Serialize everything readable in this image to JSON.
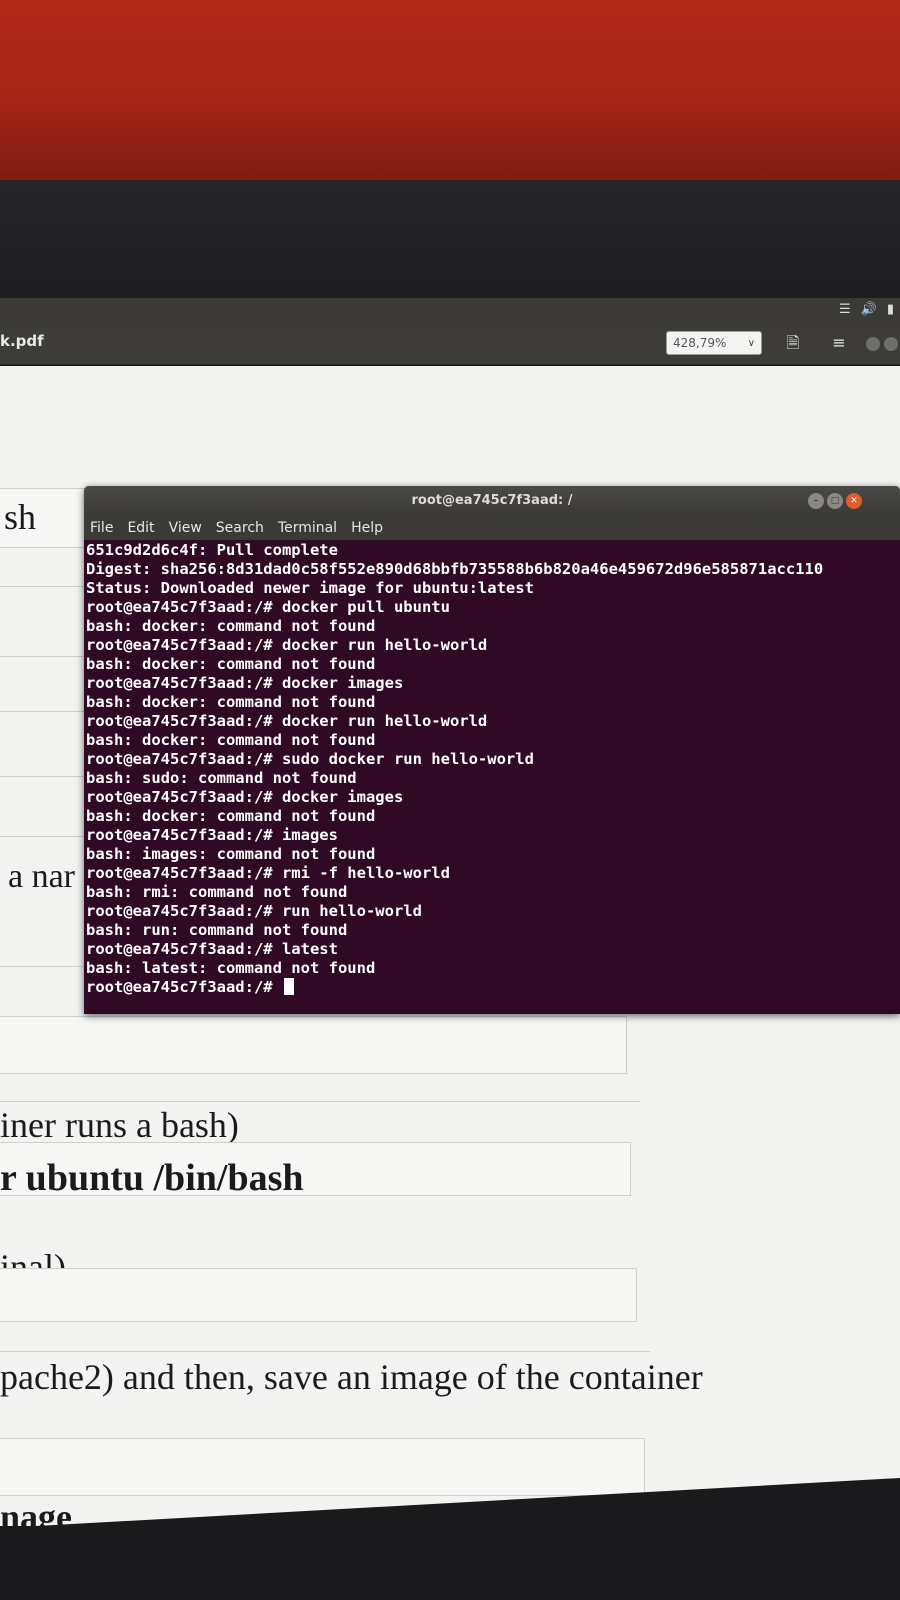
{
  "viewer": {
    "doc_title": "k.pdf",
    "zoom": "428,79%"
  },
  "pdf": {
    "frag_sh": "sh",
    "frag_name": "a nar",
    "frag_runs": "iner runs a bash)",
    "frag_ubuntu": "r ubuntu /bin/bash",
    "frag_terminal": "inal)",
    "frag_apache": "pache2) and then, save an image of the container",
    "frag_image": "nage"
  },
  "terminal": {
    "title": "root@ea745c7f3aad: /",
    "menu": [
      "File",
      "Edit",
      "View",
      "Search",
      "Terminal",
      "Help"
    ],
    "lines": [
      "651c9d2d6c4f: Pull complete",
      "Digest: sha256:8d31dad0c58f552e890d68bbfb735588b6b820a46e459672d96e585871acc110",
      "Status: Downloaded newer image for ubuntu:latest",
      "root@ea745c7f3aad:/# docker pull ubuntu",
      "bash: docker: command not found",
      "root@ea745c7f3aad:/# docker run hello-world",
      "bash: docker: command not found",
      "root@ea745c7f3aad:/# docker images",
      "bash: docker: command not found",
      "root@ea745c7f3aad:/# docker run hello-world",
      "bash: docker: command not found",
      "root@ea745c7f3aad:/# sudo docker run hello-world",
      "bash: sudo: command not found",
      "root@ea745c7f3aad:/# docker images",
      "bash: docker: command not found",
      "root@ea745c7f3aad:/# images",
      "bash: images: command not found",
      "root@ea745c7f3aad:/# rmi -f hello-world",
      "bash: rmi: command not found",
      "root@ea745c7f3aad:/# run hello-world",
      "bash: run: command not found",
      "root@ea745c7f3aad:/# latest",
      "bash: latest: command not found"
    ],
    "prompt": "root@ea745c7f3aad:/# "
  },
  "colors": {
    "terminal_bg": "#300a24",
    "close_button": "#e25b2c",
    "desk": "#b52a1a"
  },
  "icons": [
    "network-icon",
    "volume-icon",
    "battery-icon",
    "bookmark-icon",
    "hamburger-menu-icon",
    "chevron-down-icon"
  ]
}
